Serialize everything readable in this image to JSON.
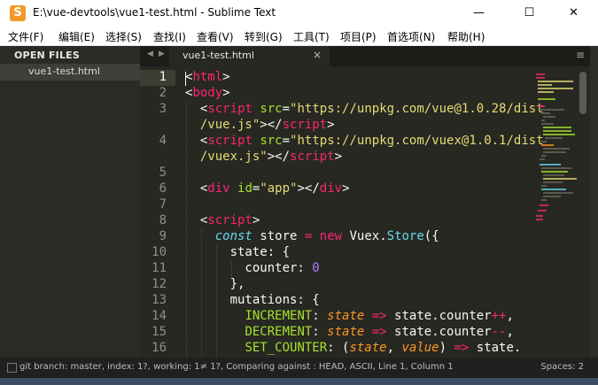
{
  "window": {
    "title": "E:\\vue-devtools\\vue1-test.html - Sublime Text",
    "app_icon": "S",
    "minimize_symbol": "—",
    "maximize_symbol": "☐",
    "close_symbol": "✕"
  },
  "menu": [
    "文件(F)",
    "编辑(E)",
    "选择(S)",
    "查找(I)",
    "查看(V)",
    "转到(G)",
    "工具(T)",
    "项目(P)",
    "首选项(N)",
    "帮助(H)"
  ],
  "sidebar": {
    "header": "OPEN FILES",
    "files": [
      "vue1-test.html"
    ]
  },
  "tabs": {
    "nav_left": "◀",
    "nav_right": "▶",
    "active_label": "vue1-test.html",
    "close_symbol": "×",
    "menu_symbol": "≡"
  },
  "editor": {
    "line_numbers": [
      "1",
      "2",
      "3",
      "",
      "4",
      "",
      "5",
      "6",
      "7",
      "8",
      "9",
      "10",
      "11",
      "12",
      "13",
      "14",
      "15",
      "16"
    ],
    "active_line": "1",
    "code": {
      "l1": [
        "<",
        "html",
        ">"
      ],
      "l2": [
        "<",
        "body",
        ">"
      ],
      "l3a": [
        "  <",
        "script",
        " ",
        "src",
        "=",
        "\"https://unpkg.com/vue@1.0.28/dist",
        ""
      ],
      "l3b": [
        "  /vue.js\"",
        "></",
        "script",
        ">"
      ],
      "l4a": [
        "  <",
        "script",
        " ",
        "src",
        "=",
        "\"https://unpkg.com/vuex@1.0.1/dist"
      ],
      "l4b": [
        "  /vuex.js\"",
        "></",
        "script",
        ">"
      ],
      "l6": [
        "  <",
        "div",
        " ",
        "id",
        "=",
        "\"app\"",
        "></",
        "div",
        ">"
      ],
      "l8": [
        "  <",
        "script",
        ">"
      ],
      "l9": [
        "    ",
        "const",
        " store ",
        "=",
        " ",
        "new",
        " Vuex.",
        "Store",
        "({"
      ],
      "l10": [
        "      state: {"
      ],
      "l11": [
        "        counter: ",
        "0"
      ],
      "l12": [
        "      },"
      ],
      "l13": [
        "      mutations: {"
      ],
      "l14": [
        "        ",
        "INCREMENT",
        ": ",
        "state",
        " ",
        "=>",
        " state.counter",
        "++",
        ","
      ],
      "l15": [
        "        ",
        "DECREMENT",
        ": ",
        "state",
        " ",
        "=>",
        " state.counter",
        "--",
        ","
      ],
      "l16": [
        "        ",
        "SET_COUNTER",
        ": (",
        "state",
        ", ",
        "value",
        ") ",
        "=>",
        " state."
      ]
    }
  },
  "status": {
    "left": "git branch: master, index: 1?, working: 1≠ 1?, Comparing against : HEAD, ASCII, Line 1, Column 1",
    "right": "Spaces: 2"
  },
  "colors": {
    "editor_bg": "#272822",
    "sidebar_bg": "#2a2b27",
    "tag": "#f92672",
    "attr": "#a6e22e",
    "string": "#e6db74",
    "keyword": "#66d9ef",
    "number": "#ae81ff",
    "param": "#fd971f"
  }
}
